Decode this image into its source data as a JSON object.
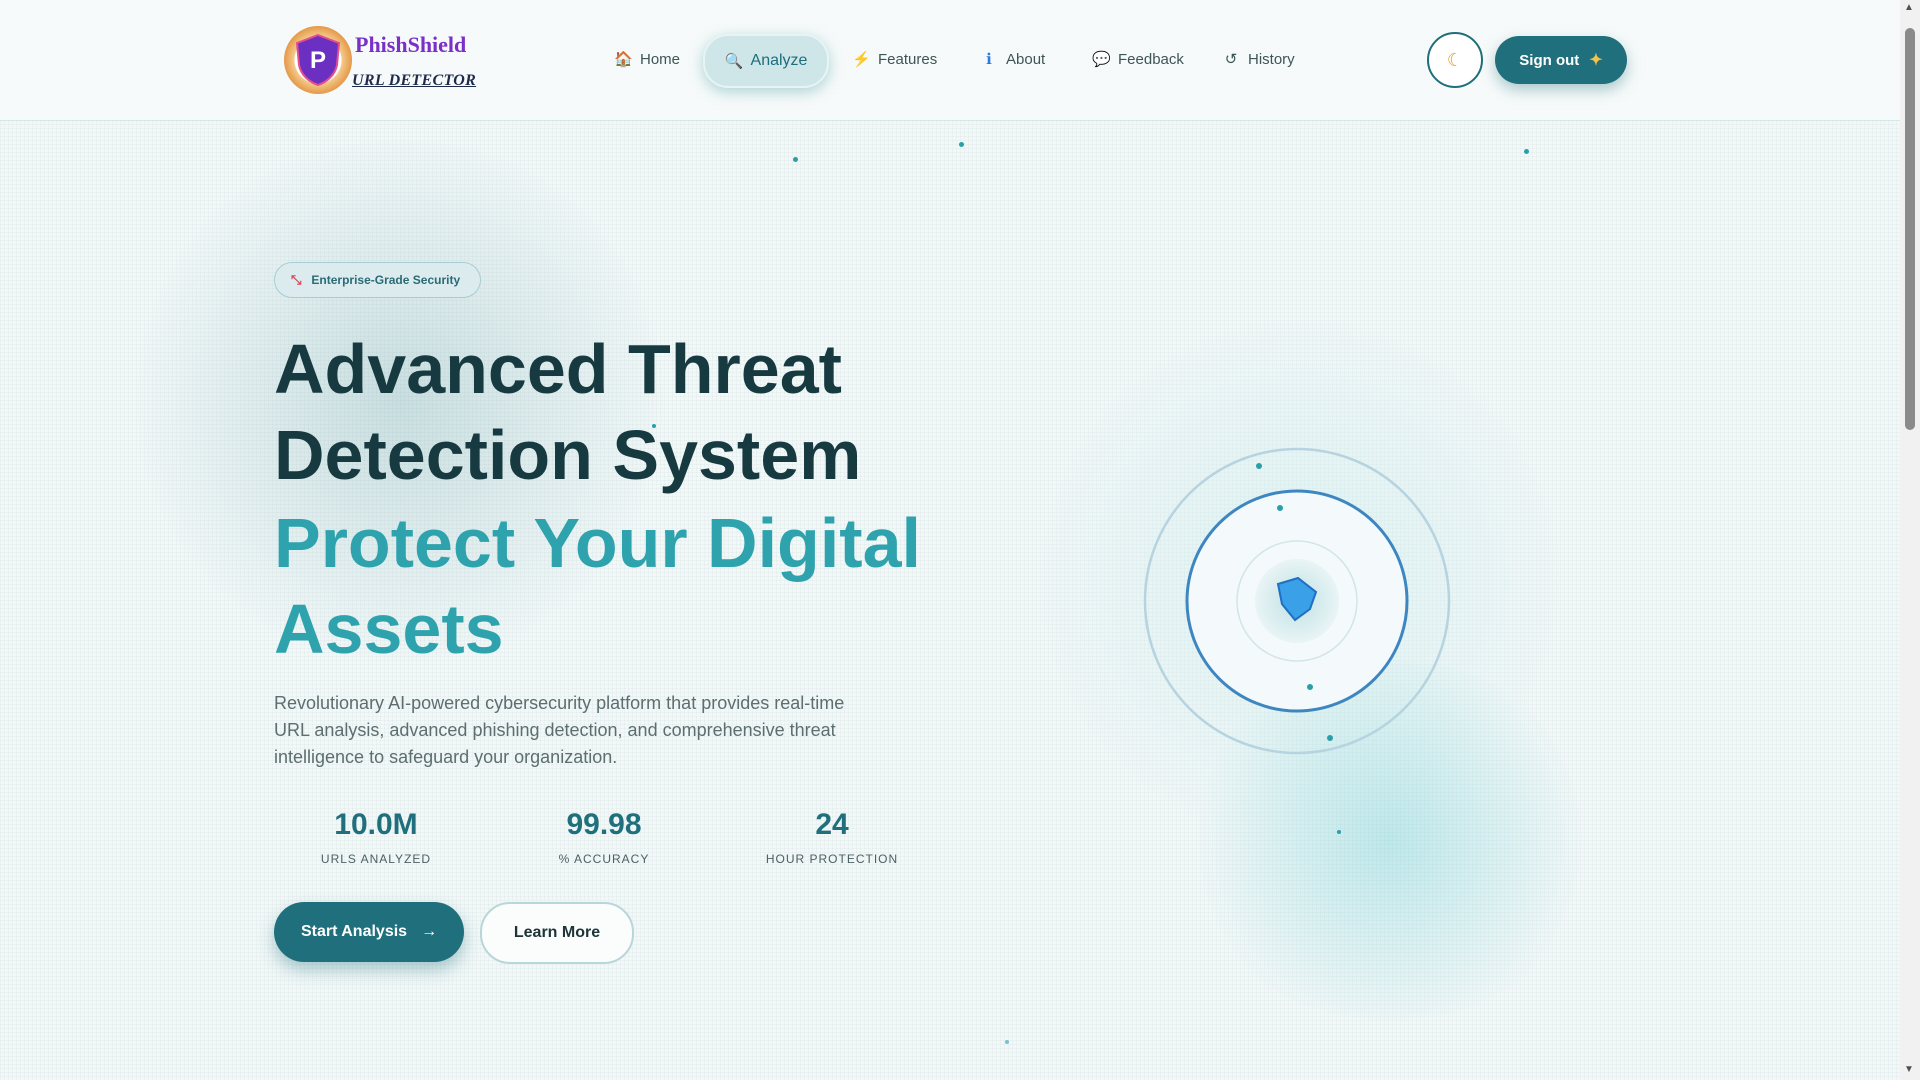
{
  "brand": {
    "name": "PhishShield",
    "subtitle": "URL DETECTOR"
  },
  "nav": [
    {
      "label": "Home",
      "icon": "home-icon",
      "glyph": "🏠",
      "active": false
    },
    {
      "label": "Analyze",
      "icon": "search-icon",
      "glyph": "🔍",
      "active": true
    },
    {
      "label": "Features",
      "icon": "lightning-icon",
      "glyph": "⚡",
      "active": false
    },
    {
      "label": "About",
      "icon": "info-icon",
      "glyph": "ℹ",
      "active": false
    },
    {
      "label": "Feedback",
      "icon": "chat-bubble-icon",
      "glyph": "💬",
      "active": false
    },
    {
      "label": "History",
      "icon": "history-icon",
      "glyph": "↺",
      "active": false
    }
  ],
  "header": {
    "theme_icon": "moon-icon",
    "signout_label": "Sign out",
    "signout_icon": "sparkle-icon"
  },
  "hero": {
    "badge": "Enterprise-Grade Security",
    "title_line1": "Advanced Threat",
    "title_line2": "Detection System",
    "highlight_line1": "Protect Your Digital",
    "highlight_line2": "Assets",
    "description": "Revolutionary AI-powered cybersecurity platform that provides real-time URL analysis, advanced phishing detection, and comprehensive threat intelligence to safeguard your organization.",
    "stats": [
      {
        "value": "10.0M",
        "label": "URLS ANALYZED"
      },
      {
        "value": "99.98",
        "label": "% ACCURACY"
      },
      {
        "value": "24",
        "label": "HOUR PROTECTION"
      }
    ],
    "primary_button": "Start Analysis",
    "primary_arrow": "→",
    "secondary_button": "Learn More"
  },
  "colors": {
    "accent": "#206f7c",
    "highlight": "#2ea3ad",
    "brand": "#7a2fc8"
  }
}
